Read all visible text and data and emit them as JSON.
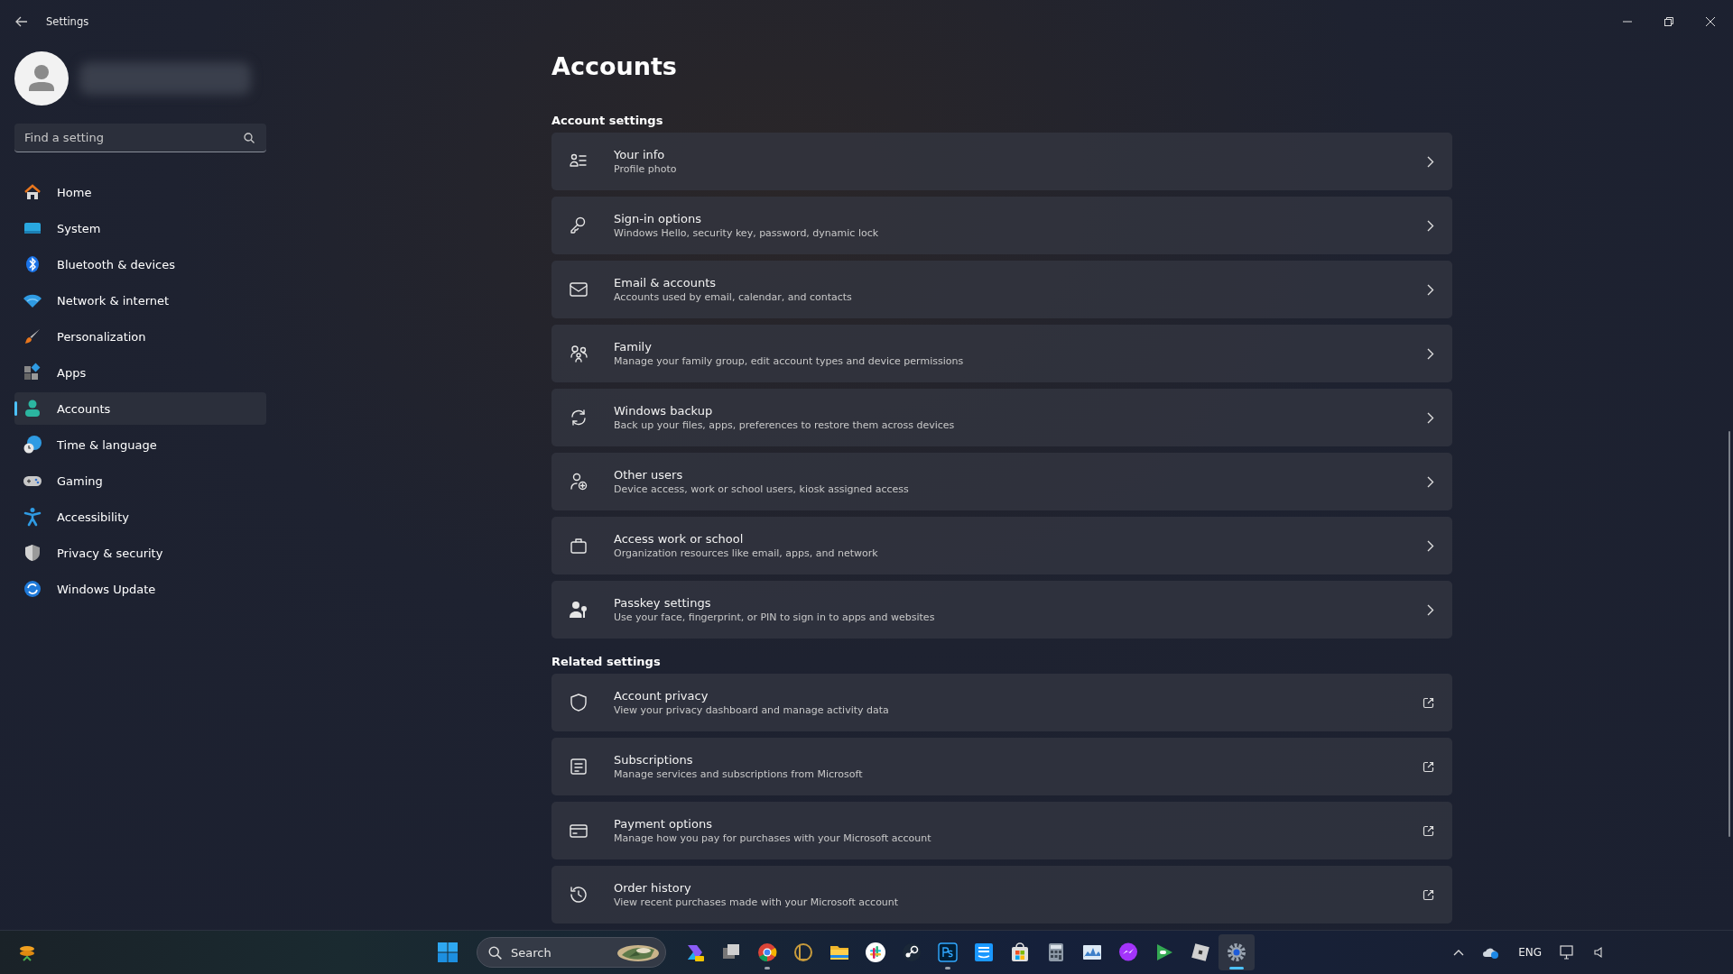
{
  "window": {
    "title": "Settings"
  },
  "search": {
    "placeholder": "Find a setting"
  },
  "nav": [
    {
      "label": "Home",
      "selected": false
    },
    {
      "label": "System",
      "selected": false
    },
    {
      "label": "Bluetooth & devices",
      "selected": false
    },
    {
      "label": "Network & internet",
      "selected": false
    },
    {
      "label": "Personalization",
      "selected": false
    },
    {
      "label": "Apps",
      "selected": false
    },
    {
      "label": "Accounts",
      "selected": true
    },
    {
      "label": "Time & language",
      "selected": false
    },
    {
      "label": "Gaming",
      "selected": false
    },
    {
      "label": "Accessibility",
      "selected": false
    },
    {
      "label": "Privacy & security",
      "selected": false
    },
    {
      "label": "Windows Update",
      "selected": false
    }
  ],
  "page_title": "Accounts",
  "sections": [
    {
      "heading": "Account settings",
      "items": [
        {
          "title": "Your info",
          "subtitle": "Profile photo",
          "kind": "chevron"
        },
        {
          "title": "Sign-in options",
          "subtitle": "Windows Hello, security key, password, dynamic lock",
          "kind": "chevron"
        },
        {
          "title": "Email & accounts",
          "subtitle": "Accounts used by email, calendar, and contacts",
          "kind": "chevron"
        },
        {
          "title": "Family",
          "subtitle": "Manage your family group, edit account types and device permissions",
          "kind": "chevron"
        },
        {
          "title": "Windows backup",
          "subtitle": "Back up your files, apps, preferences to restore them across devices",
          "kind": "chevron"
        },
        {
          "title": "Other users",
          "subtitle": "Device access, work or school users, kiosk assigned access",
          "kind": "chevron"
        },
        {
          "title": "Access work or school",
          "subtitle": "Organization resources like email, apps, and network",
          "kind": "chevron"
        },
        {
          "title": "Passkey settings",
          "subtitle": "Use your face, fingerprint, or PIN to sign in to apps and websites",
          "kind": "chevron"
        }
      ]
    },
    {
      "heading": "Related settings",
      "items": [
        {
          "title": "Account privacy",
          "subtitle": "View your privacy dashboard and manage activity data",
          "kind": "external"
        },
        {
          "title": "Subscriptions",
          "subtitle": "Manage services and subscriptions from Microsoft",
          "kind": "external"
        },
        {
          "title": "Payment options",
          "subtitle": "Manage how you pay for purchases with your Microsoft account",
          "kind": "external"
        },
        {
          "title": "Order history",
          "subtitle": "View recent purchases made with your Microsoft account",
          "kind": "external"
        }
      ]
    }
  ],
  "taskbar": {
    "search": "Search",
    "apps": [
      {
        "running": false,
        "selected": false
      },
      {
        "running": false,
        "selected": false
      },
      {
        "running": true,
        "selected": false
      },
      {
        "running": false,
        "selected": false
      },
      {
        "running": false,
        "selected": false
      },
      {
        "running": false,
        "selected": false
      },
      {
        "running": false,
        "selected": false
      },
      {
        "running": true,
        "selected": false
      },
      {
        "running": false,
        "selected": false
      },
      {
        "running": false,
        "selected": false
      },
      {
        "running": false,
        "selected": false
      },
      {
        "running": false,
        "selected": false
      },
      {
        "running": false,
        "selected": false
      },
      {
        "running": false,
        "selected": false
      },
      {
        "running": false,
        "selected": false
      },
      {
        "running": true,
        "selected": true
      }
    ],
    "language": "ENG"
  }
}
